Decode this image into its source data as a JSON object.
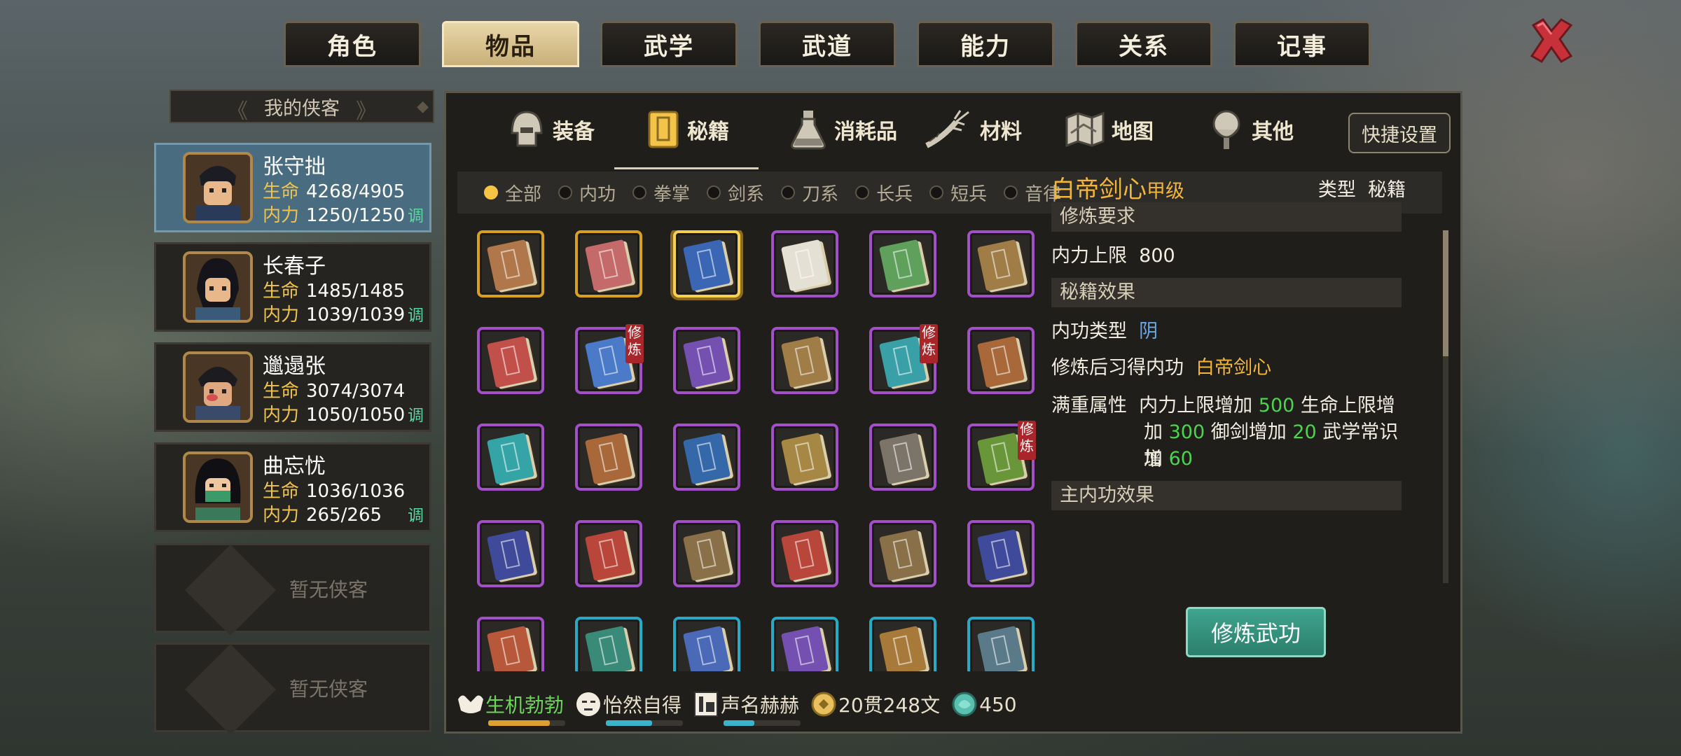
{
  "top_tabs": [
    "角色",
    "物品",
    "武学",
    "武道",
    "能力",
    "关系",
    "记事"
  ],
  "active_top_tab": 1,
  "sidebar": {
    "title": "我的侠客",
    "characters": [
      {
        "name": "张守拙",
        "hp_label": "生命",
        "hp": "4268/4905",
        "mp_label": "内力",
        "mp": "1250/1250",
        "adjust": "调",
        "active": true
      },
      {
        "name": "长春子",
        "hp_label": "生命",
        "hp": "1485/1485",
        "mp_label": "内力",
        "mp": "1039/1039",
        "adjust": "调"
      },
      {
        "name": "邋遢张",
        "hp_label": "生命",
        "hp": "3074/3074",
        "mp_label": "内力",
        "mp": "1050/1050",
        "adjust": "调"
      },
      {
        "name": "曲忘忧",
        "hp_label": "生命",
        "hp": "1036/1036",
        "mp_label": "内力",
        "mp": "265/265",
        "adjust": "调"
      }
    ],
    "empty_slots": [
      "暂无侠客",
      "暂无侠客"
    ]
  },
  "categories": [
    {
      "label": "装备",
      "icon": "helmet-icon"
    },
    {
      "label": "秘籍",
      "icon": "scroll-book-icon"
    },
    {
      "label": "消耗品",
      "icon": "potion-flask-icon"
    },
    {
      "label": "材料",
      "icon": "herb-root-icon"
    },
    {
      "label": "地图",
      "icon": "map-icon"
    },
    {
      "label": "其他",
      "icon": "lantern-icon"
    }
  ],
  "active_category": 1,
  "quick_settings": "快捷设置",
  "filters": [
    "全部",
    "内功",
    "拳掌",
    "剑系",
    "刀系",
    "长兵",
    "短兵",
    "音律"
  ],
  "active_filter": 0,
  "train_tag": "修炼",
  "items": [
    {
      "color": "#b0774a",
      "frame": "gold"
    },
    {
      "color": "#c46a6a",
      "frame": "gold"
    },
    {
      "color": "#3a66b4",
      "frame": "gold",
      "selected": true
    },
    {
      "color": "#e4e0d4",
      "frame": "purple"
    },
    {
      "color": "#5ea05c",
      "frame": "purple"
    },
    {
      "color": "#a07c46",
      "frame": "purple"
    },
    {
      "color": "#c2504a",
      "frame": "purple"
    },
    {
      "color": "#4a7ac8",
      "frame": "purple",
      "training": true
    },
    {
      "color": "#7450b0",
      "frame": "purple"
    },
    {
      "color": "#a07c46",
      "frame": "purple"
    },
    {
      "color": "#3aa0a8",
      "frame": "purple",
      "training": true
    },
    {
      "color": "#a8683a",
      "frame": "purple"
    },
    {
      "color": "#34a4a6",
      "frame": "purple"
    },
    {
      "color": "#a8683a",
      "frame": "purple"
    },
    {
      "color": "#3468a8",
      "frame": "purple"
    },
    {
      "color": "#a68844",
      "frame": "purple"
    },
    {
      "color": "#7c7468",
      "frame": "purple"
    },
    {
      "color": "#6a963a",
      "frame": "purple",
      "training": true
    },
    {
      "color": "#404a9a",
      "frame": "purple"
    },
    {
      "color": "#b8463a",
      "frame": "purple"
    },
    {
      "color": "#8a7048",
      "frame": "purple"
    },
    {
      "color": "#b8463a",
      "frame": "purple"
    },
    {
      "color": "#8a7048",
      "frame": "purple"
    },
    {
      "color": "#404a9a",
      "frame": "purple"
    },
    {
      "color": "#b8583a",
      "frame": "purple"
    },
    {
      "color": "#3a8a7a",
      "frame": "cyan"
    },
    {
      "color": "#4a6ab8",
      "frame": "cyan"
    },
    {
      "color": "#7450b0",
      "frame": "cyan"
    },
    {
      "color": "#a87a3a",
      "frame": "cyan"
    },
    {
      "color": "#5a7a8a",
      "frame": "cyan"
    }
  ],
  "detail": {
    "name": "白帝剑心",
    "grade": "甲级",
    "type_label": "类型",
    "type_value": "秘籍",
    "sec_require": "修炼要求",
    "req_key": "内力上限",
    "req_val": "800",
    "sec_effect": "秘籍效果",
    "neigong_key": "内功类型",
    "neigong_val": "阴",
    "learn_key": "修炼后习得内功",
    "learn_val": "白帝剑心",
    "full_key": "满重属性",
    "full_l1a": "内力上限增加 ",
    "full_l1b": "500",
    "full_l1c": " 生命上限增",
    "full_l2a": "加 ",
    "full_l2b": "300",
    "full_l2c": " 御剑增加 ",
    "full_l2d": "20",
    "full_l2e": " 武学常识增",
    "full_l3a": "加 ",
    "full_l3b": "60",
    "sec_main": "主内功效果"
  },
  "train_button": "修炼武功",
  "status": [
    {
      "label": "生机勃勃",
      "icon": "muscle-icon",
      "color": "#6ed45a",
      "bar": 0.8,
      "bar_color": "#e0a030"
    },
    {
      "label": "怡然自得",
      "icon": "calm-face-icon",
      "color": "#f2ede0",
      "bar": 0.6,
      "bar_color": "#3ab4c8"
    },
    {
      "label": "声名赫赫",
      "icon": "banner-icon",
      "color": "#f2ede0",
      "bar": 0.4,
      "bar_color": "#3ab4c8"
    },
    {
      "label": "20贯248文",
      "icon": "coin-icon",
      "color": "#f2ede0"
    },
    {
      "label": "450",
      "icon": "jade-icon",
      "color": "#f2ede0"
    }
  ]
}
